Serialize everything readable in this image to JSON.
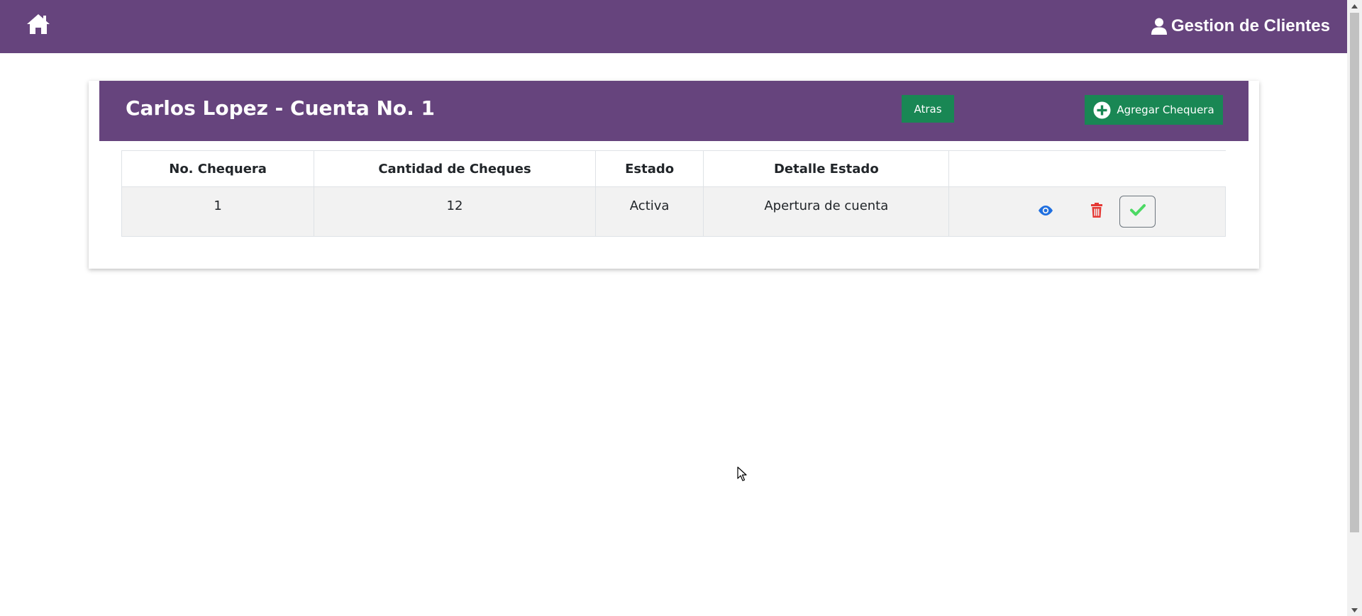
{
  "navbar": {
    "home_icon": "home-icon",
    "brand_icon": "user-icon",
    "brand_label": "Gestion de Clientes",
    "background_color": "#66447d"
  },
  "card": {
    "title": "Carlos Lopez - Cuenta No. 1",
    "back_button_label": "Atras",
    "add_button_label": "Agregar Chequera",
    "add_button_icon": "plus-circle-icon",
    "button_color": "#198754"
  },
  "table": {
    "headers": [
      "No. Chequera",
      "Cantidad de Cheques",
      "Estado",
      "Detalle Estado",
      ""
    ],
    "rows": [
      {
        "numero": "1",
        "cantidad": "12",
        "estado": "Activa",
        "detalle": "Apertura de cuenta",
        "actions": [
          "eye-icon",
          "trash-icon",
          "check-icon"
        ]
      }
    ]
  },
  "colors": {
    "view_icon": "#1f6fe0",
    "delete_icon": "#e53935",
    "confirm_icon": "#4cd964"
  }
}
